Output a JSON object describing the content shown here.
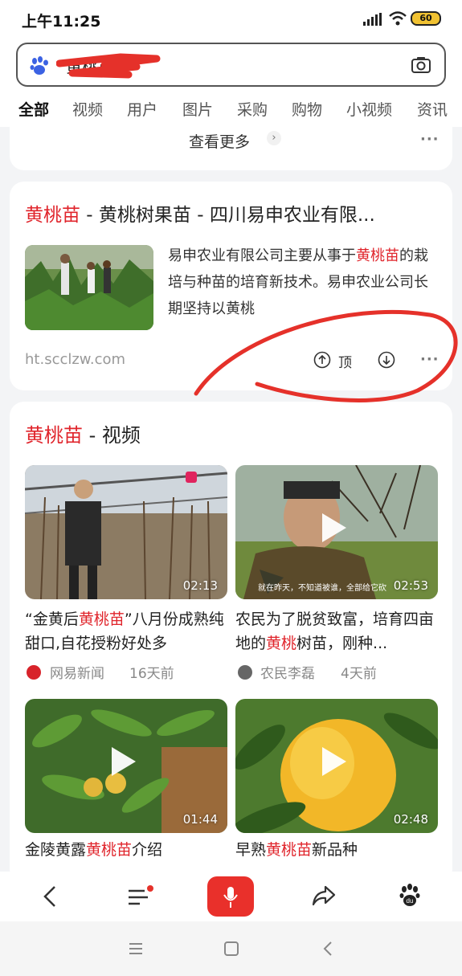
{
  "status": {
    "time": "上午11:25",
    "battery": "60"
  },
  "search": {
    "query": "黄桃苗"
  },
  "tabs": [
    "全部",
    "视频",
    "用户",
    "图片",
    "采购",
    "购物",
    "小视频",
    "资讯"
  ],
  "prev_card": {
    "more_label": "查看更多",
    "more_icon": "chevron-right-icon"
  },
  "result": {
    "title_highlight": "黄桃苗",
    "title_rest": " - 黄桃树果苗 - 四川易申农业有限...",
    "desc_parts": [
      "易申农业有限公司主要从事于",
      "黄桃苗",
      "的栽培与种苗的培育新技术。易申农业公司长期坚持以黄桃"
    ],
    "url": "ht.scclzw.com",
    "upvote_label": "顶"
  },
  "videos": {
    "title_highlight": "黄桃苗",
    "title_rest": " - 视频",
    "items": [
      {
        "cap": [
          "“金黄后",
          "黄桃苗",
          "”八月份成熟纯甜口,自花授粉好处多"
        ],
        "duration": "02:13",
        "source": "网易新闻",
        "age": "16天前"
      },
      {
        "cap": [
          "农民为了脱贫致富，培育四亩地的",
          "黄桃",
          "树苗，刚种..."
        ],
        "duration": "02:53",
        "source": "农民李磊",
        "age": "4天前",
        "subtitle": "就在昨天，不知道被谁，全部给它砍"
      },
      {
        "cap": [
          "金陵黄露",
          "黄桃苗",
          "介绍"
        ],
        "duration": "01:44"
      },
      {
        "cap": [
          "早熟",
          "黄桃苗",
          "新品种"
        ],
        "duration": "02:48"
      }
    ]
  },
  "colors": {
    "highlight": "#e0242b",
    "accent": "#3a5ef5",
    "mic": "#e9302b",
    "annotation": "#e5312a"
  }
}
